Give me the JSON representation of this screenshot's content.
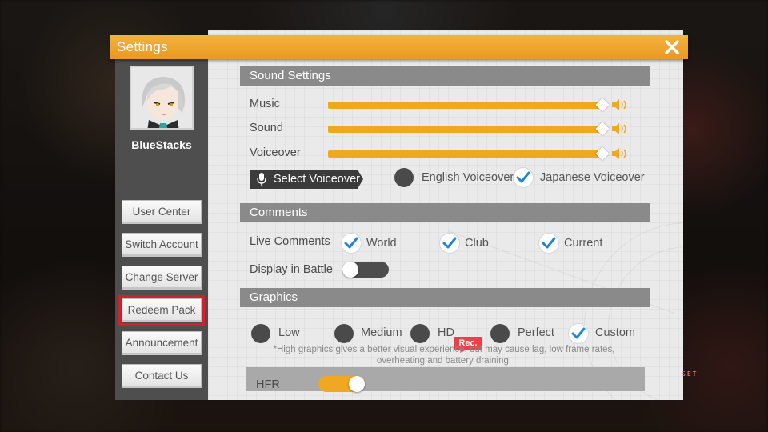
{
  "dialog": {
    "title": "Settings"
  },
  "profile": {
    "username": "BlueStacks"
  },
  "sidebar": {
    "items": [
      {
        "label": "User Center"
      },
      {
        "label": "Switch Account"
      },
      {
        "label": "Change Server"
      },
      {
        "label": "Redeem Pack",
        "highlighted": true
      },
      {
        "label": "Announcement"
      },
      {
        "label": "Contact Us"
      }
    ]
  },
  "sound": {
    "header": "Sound Settings",
    "music_label": "Music",
    "music_level": 1.0,
    "sound_label": "Sound",
    "sound_level": 1.0,
    "voiceover_label": "Voiceover",
    "voiceover_level": 1.0,
    "select_voiceover_label": "Select Voiceover",
    "english_voiceover": "English Voiceover",
    "english_selected": false,
    "japanese_voiceover": "Japanese Voiceover",
    "japanese_selected": true
  },
  "comments": {
    "header": "Comments",
    "live_comments_label": "Live Comments",
    "world": "World",
    "world_checked": true,
    "club": "Club",
    "club_checked": true,
    "current": "Current",
    "current_checked": true,
    "display_in_battle_label": "Display in Battle",
    "display_in_battle_on": false
  },
  "graphics": {
    "header": "Graphics",
    "options": [
      "Low",
      "Medium",
      "HD",
      "Perfect",
      "Custom"
    ],
    "selected": "Custom",
    "rec_badge": "Rec.",
    "note_line1": "*High graphics gives a better visual experience, but may cause lag, low frame rates,",
    "note_line2": "overheating and battery draining.",
    "hfr_label": "HFR",
    "hfr_on": true
  },
  "side_text": "SET",
  "colors": {
    "accent": "#f0a823",
    "title_bar": "#eea12b",
    "check_blue": "#1f86d8",
    "highlight_red": "#d0222c"
  },
  "icons": {
    "close": "close-icon",
    "speaker": "speaker-icon",
    "mic": "mic-icon",
    "check": "check-icon"
  }
}
